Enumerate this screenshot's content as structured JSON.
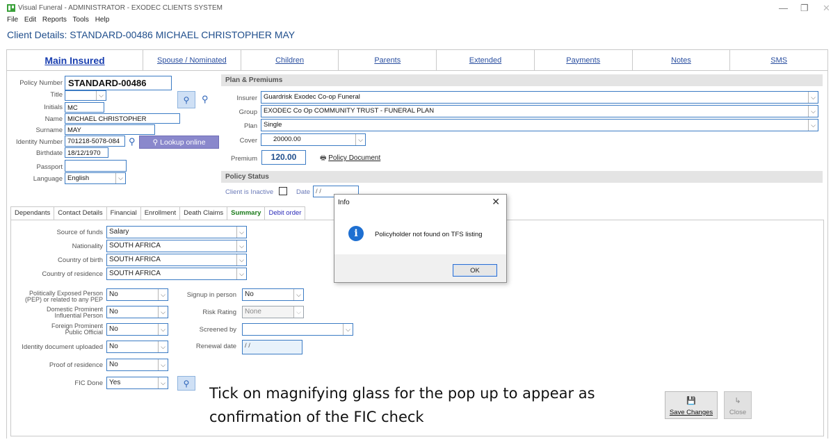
{
  "window": {
    "title": "Visual Funeral - ADMINISTRATOR - EXODEC CLIENTS SYSTEM",
    "minimize": "—",
    "restore": "❐",
    "close": "✕"
  },
  "menu": [
    "File",
    "Edit",
    "Reports",
    "Tools",
    "Help"
  ],
  "client_header": "Client Details: STANDARD-00486 MICHAEL CHRISTOPHER MAY",
  "top_tabs": [
    "Main Insured",
    "Spouse / Nominated",
    "Children",
    "Parents",
    "Extended",
    "Payments",
    "Notes",
    "SMS"
  ],
  "insured": {
    "policy_number_label": "Policy Number",
    "policy_number": "STANDARD-00486",
    "title_label": "Title",
    "title": "",
    "initials_label": "Initials",
    "initials": "MC",
    "name_label": "Name",
    "name": "MICHAEL CHRISTOPHER",
    "surname_label": "Surname",
    "surname": "MAY",
    "id_label": "Identity Number",
    "id_number": "701218-5078-084",
    "lookup_label": "Lookup online",
    "birthdate_label": "Birthdate",
    "birthdate": "18/12/1970",
    "passport_label": "Passport",
    "passport": "",
    "language_label": "Language",
    "language": "English"
  },
  "plan": {
    "header": "Plan & Premiums",
    "insurer_label": "Insurer",
    "insurer": "Guardrisk Exodec Co-op Funeral",
    "group_label": "Group",
    "group": "EXODEC Co Op COMMUNITY TRUST - FUNERAL PLAN",
    "plan_label": "Plan",
    "plan": "Single",
    "cover_label": "Cover",
    "cover": "20000.00",
    "premium_label": "Premium",
    "premium": "120.00",
    "policy_document": "Policy Document"
  },
  "status": {
    "header": "Policy Status",
    "inactive_label": "Client is Inactive",
    "date_label": "Date",
    "date": "/ /"
  },
  "lower_tabs": [
    "Dependants",
    "Contact Details",
    "Financial",
    "Enrollment",
    "Death Claims",
    "Summary",
    "Debit order"
  ],
  "fica": {
    "source_label": "Source of funds",
    "source": "Salary",
    "nationality_label": "Nationality",
    "nationality": "SOUTH AFRICA",
    "birth_country_label": "Country of birth",
    "birth_country": "SOUTH AFRICA",
    "residence_label": "Country of residence",
    "residence": "SOUTH AFRICA",
    "pep_label_1": "Politically Exposed Person",
    "pep_label_2": "(PEP) or related to any PEP",
    "pep": "No",
    "dpip_label_1": "Domestic Prominent",
    "dpip_label_2": "Influential Person",
    "dpip": "No",
    "fppo_label_1": "Foreign Prominent",
    "fppo_label_2": "Public Official",
    "fppo": "No",
    "id_doc_label": "Identity document uploaded",
    "id_doc": "No",
    "proof_label": "Proof of residence",
    "proof": "No",
    "fic_label": "FIC Done",
    "fic": "Yes",
    "signup_label": "Signup in person",
    "signup": "No",
    "risk_label": "Risk Rating",
    "risk": "None",
    "screened_label": "Screened by",
    "screened": "",
    "renewal_label": "Renewal date",
    "renewal": "/ /"
  },
  "dialog": {
    "title": "Info",
    "message": "Policyholder not found on TFS listing",
    "ok": "OK"
  },
  "annotation_line1": "Tick on magnifying glass for the pop up to appear as",
  "annotation_line2": "confirmation of the FIC check",
  "buttons": {
    "save": "Save Changes",
    "close": "Close"
  }
}
